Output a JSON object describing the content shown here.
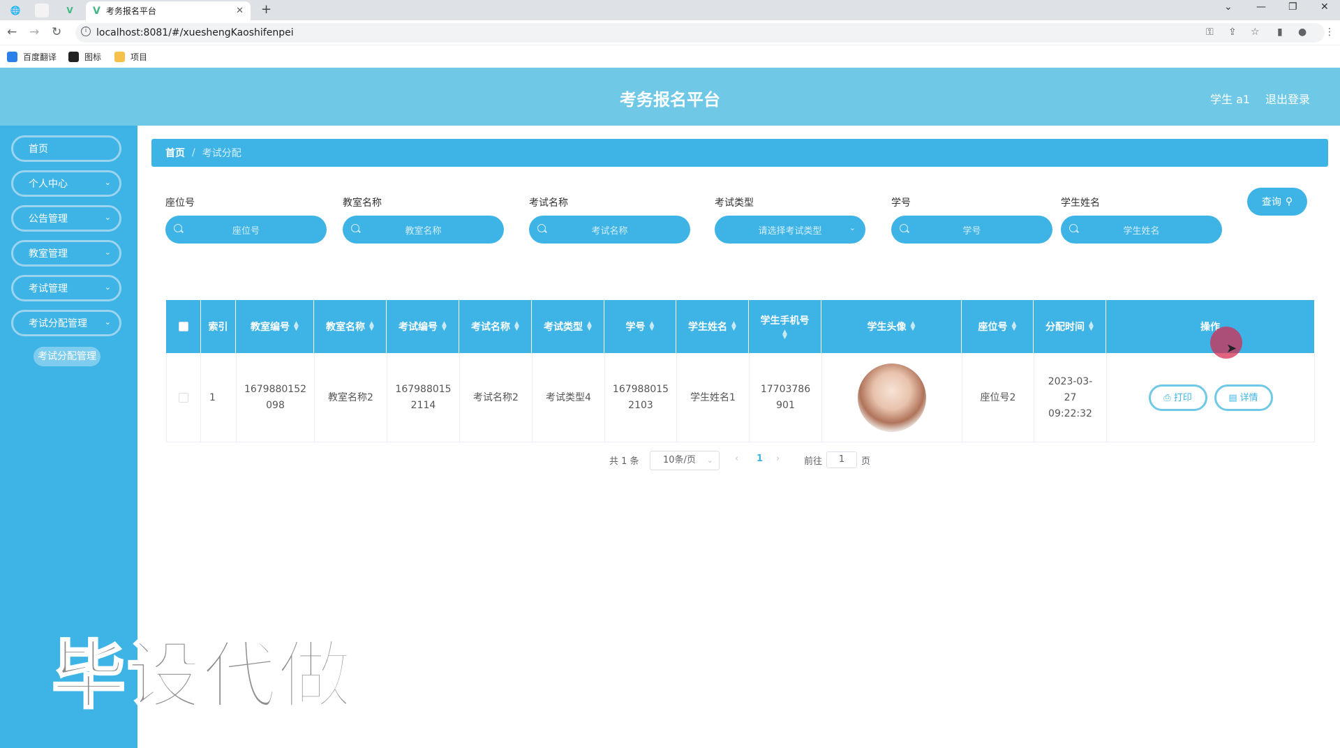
{
  "browser": {
    "tab_title": "考务报名平台",
    "url": "localhost:8081/#/xueshengKaoshifenpei",
    "bookmarks": [
      {
        "label": "百度翻译",
        "color": "#2b7fe8"
      },
      {
        "label": "图标",
        "color": "#222222"
      },
      {
        "label": "项目",
        "color": "#f5c14b"
      }
    ]
  },
  "header": {
    "title": "考务报名平台",
    "user": "学生 a1",
    "logout": "退出登录"
  },
  "sidebar": {
    "items": [
      {
        "label": "首页",
        "has_arrow": false
      },
      {
        "label": "个人中心",
        "has_arrow": true
      },
      {
        "label": "公告管理",
        "has_arrow": true
      },
      {
        "label": "教室管理",
        "has_arrow": true
      },
      {
        "label": "考试管理",
        "has_arrow": true
      },
      {
        "label": "考试分配管理",
        "has_arrow": true
      }
    ],
    "active_sub": "考试分配管理"
  },
  "breadcrumb": {
    "home": "首页",
    "separator": "/",
    "current": "考试分配"
  },
  "filters": [
    {
      "label": "座位号",
      "placeholder": "座位号",
      "type": "input"
    },
    {
      "label": "教室名称",
      "placeholder": "教室名称",
      "type": "input"
    },
    {
      "label": "考试名称",
      "placeholder": "考试名称",
      "type": "input"
    },
    {
      "label": "考试类型",
      "placeholder": "请选择考试类型",
      "type": "select"
    },
    {
      "label": "学号",
      "placeholder": "学号",
      "type": "input"
    },
    {
      "label": "学生姓名",
      "placeholder": "学生姓名",
      "type": "input"
    }
  ],
  "query_button": "查询",
  "table": {
    "columns": [
      "",
      "索引",
      "教室编号",
      "教室名称",
      "考试编号",
      "考试名称",
      "考试类型",
      "学号",
      "学生姓名",
      "学生手机号",
      "学生头像",
      "座位号",
      "分配时间",
      "操作"
    ],
    "rows": [
      {
        "index": "1",
        "classroom_no": "1679880152098",
        "classroom_name": "教室名称2",
        "exam_no": "1679880152114",
        "exam_name": "考试名称2",
        "exam_type": "考试类型4",
        "student_no": "1679880152103",
        "student_name": "学生姓名1",
        "phone": "17703786901",
        "seat": "座位号2",
        "time": "2023-03-27 09:22:32"
      }
    ],
    "actions": {
      "print": "打印",
      "detail": "详情"
    }
  },
  "pagination": {
    "total_text": "共 1 条",
    "page_size": "10条/页",
    "current_page": "1",
    "goto_label": "前往",
    "goto_value": "1",
    "page_unit": "页"
  },
  "watermark": "毕设代做",
  "colors": {
    "header": "#6ec8e6",
    "primary": "#3eb4e6",
    "cursor_highlight": "#d6284e"
  }
}
